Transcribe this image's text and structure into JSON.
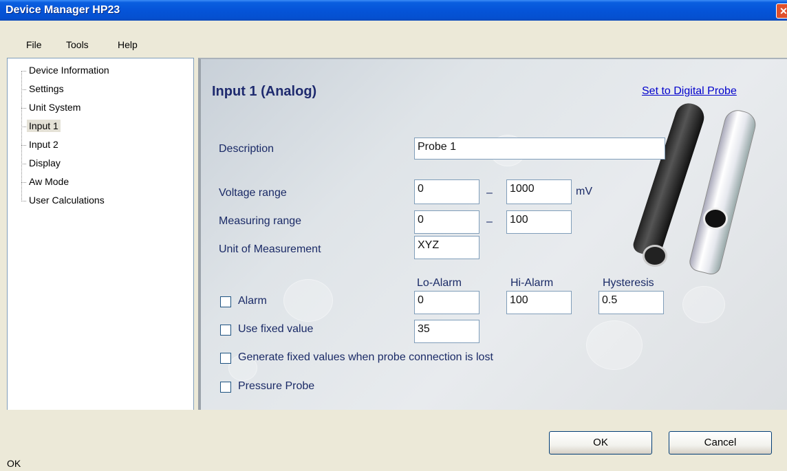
{
  "window": {
    "title": "Device Manager HP23",
    "close_glyph": "✕"
  },
  "menu": {
    "file": "File",
    "tools": "Tools",
    "help": "Help"
  },
  "tree": {
    "items": [
      {
        "label": "Device Information",
        "selected": false
      },
      {
        "label": "Settings",
        "selected": false
      },
      {
        "label": "Unit System",
        "selected": false
      },
      {
        "label": "Input 1",
        "selected": true
      },
      {
        "label": "Input 2",
        "selected": false
      },
      {
        "label": "Display",
        "selected": false
      },
      {
        "label": "Aw Mode",
        "selected": false
      },
      {
        "label": "User Calculations",
        "selected": false
      }
    ]
  },
  "panel": {
    "title": "Input 1 (Analog)",
    "digital_link": "Set to Digital Probe",
    "description_label": "Description",
    "description_value": "Probe 1",
    "voltage_label": "Voltage range",
    "voltage_min": "0",
    "voltage_max": "1000",
    "voltage_unit": "mV",
    "measuring_label": "Measuring range",
    "measuring_min": "0",
    "measuring_max": "100",
    "unit_label": "Unit of Measurement",
    "unit_value": "XYZ",
    "range_dash": "–",
    "lo_alarm_header": "Lo-Alarm",
    "hi_alarm_header": "Hi-Alarm",
    "hysteresis_header": "Hysteresis",
    "alarm_label": "Alarm",
    "lo_alarm_value": "0",
    "hi_alarm_value": "100",
    "hysteresis_value": "0.5",
    "fixed_value_label": "Use fixed value",
    "fixed_value": "35",
    "generate_label": "Generate fixed values when probe connection is lost",
    "pressure_label": "Pressure Probe"
  },
  "footer": {
    "ok": "OK",
    "cancel": "Cancel",
    "status": "OK"
  },
  "colors": {
    "title_bar": "#0554d8",
    "label_text": "#1a2a66",
    "link": "#0000cc"
  }
}
